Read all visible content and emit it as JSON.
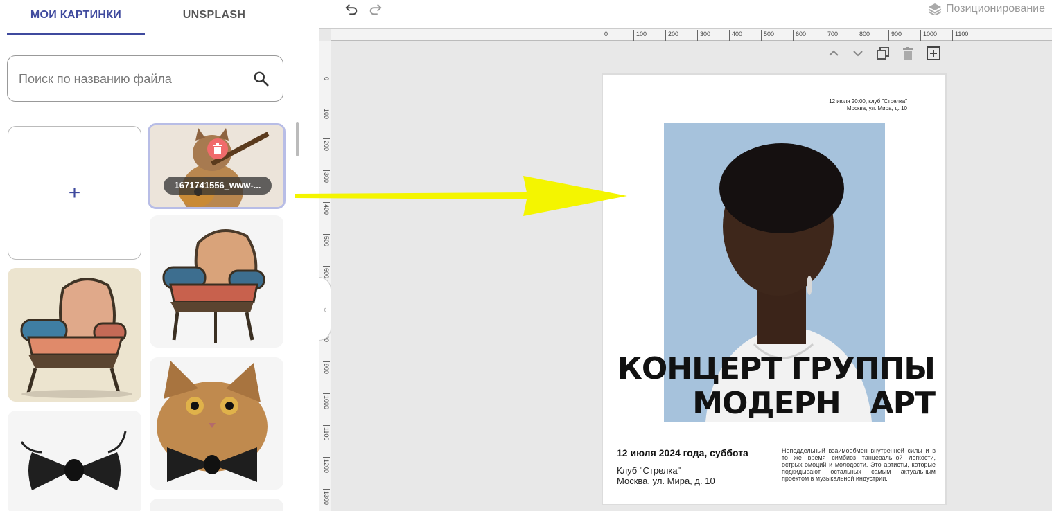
{
  "left_panel": {
    "tabs": [
      {
        "label": "МОИ КАРТИНКИ",
        "active": true
      },
      {
        "label": "UNSPLASH",
        "active": false
      }
    ],
    "search": {
      "placeholder": "Поиск по названию файла",
      "value": ""
    },
    "add_tile_symbol": "+",
    "selected_image": {
      "label": "1671741556_www-..."
    },
    "images": [
      "cat-guitar",
      "ornate-armchair",
      "ornate-armchair-drawing",
      "cat-with-bowtie",
      "bowtie"
    ]
  },
  "toolbar": {
    "undo_icon": "undo-icon",
    "redo_icon": "redo-icon",
    "positioning_label": "Позиционирование"
  },
  "rulers": {
    "horizontal": [
      "0",
      "100",
      "200",
      "300",
      "400",
      "500",
      "600",
      "700",
      "800",
      "900",
      "1000",
      "1100"
    ],
    "vertical": [
      "0",
      "100",
      "200",
      "300",
      "400",
      "500",
      "600",
      "700",
      "800",
      "900",
      "1000",
      "1100",
      "1200",
      "1300"
    ]
  },
  "page_controls": [
    "chevron-up-icon",
    "chevron-down-icon",
    "duplicate-icon",
    "trash-icon",
    "add-page-icon"
  ],
  "poster": {
    "top_line1": "12 июля 20:00, клуб \"Стрелка\"",
    "top_line2": "Москва, ул. Мира, д. 10",
    "headline_line1": "КОНЦЕРТ ГРУППЫ",
    "headline_line2": "МОДЕРН   АРТ",
    "date": "12 июля 2024 года, суббота",
    "venue_line1": "Клуб \"Стрелка\"",
    "venue_line2": "Москва, ул. Мира, д. 10",
    "description": "Неподдельный взаимообмен внутренней силы и в то же время симбиоз танцевальной легкости, острых эмоций и молодости. Это артисты, которые подкидывают остальных самым актуальным проектом в музыкальной индустрии."
  },
  "colors": {
    "accent": "#3f4a9e",
    "arrow": "#f4f500",
    "delete": "#f06b6b",
    "photo_bg": "#a6c2dc"
  }
}
